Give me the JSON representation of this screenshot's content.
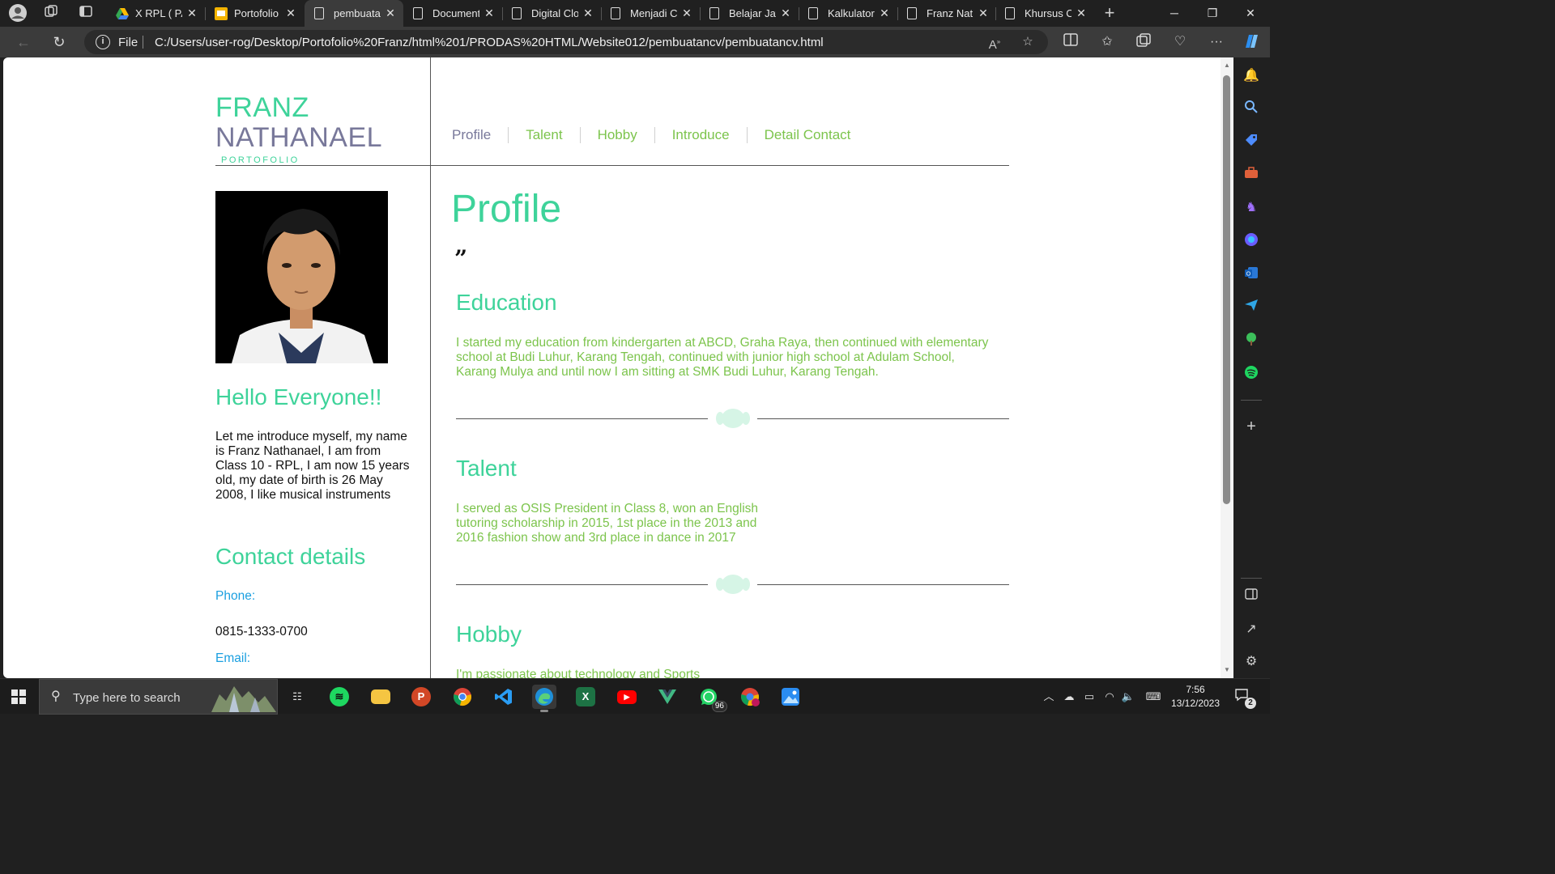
{
  "browser": {
    "tabs": [
      {
        "title": "X RPL ( PA",
        "icon": "google-drive-icon",
        "active": false
      },
      {
        "title": "Portofolio",
        "icon": "google-slides-icon",
        "active": false
      },
      {
        "title": "pembuata",
        "icon": "file-icon",
        "active": true
      },
      {
        "title": "Document",
        "icon": "file-icon",
        "active": false
      },
      {
        "title": "Digital Clo",
        "icon": "file-icon",
        "active": false
      },
      {
        "title": "Menjadi C",
        "icon": "file-icon",
        "active": false
      },
      {
        "title": "Belajar Jav",
        "icon": "file-icon",
        "active": false
      },
      {
        "title": "Kalkulator",
        "icon": "file-icon",
        "active": false
      },
      {
        "title": "Franz Nath",
        "icon": "file-icon",
        "active": false
      },
      {
        "title": "Khursus C",
        "icon": "file-icon",
        "active": false
      }
    ],
    "address": {
      "scheme_label": "File",
      "url": "C:/Users/user-rog/Desktop/Portofolio%20Franz/html%201/PRODAS%20HTML/Website012/pembuatancv/pembuatancv.html"
    }
  },
  "site": {
    "logo": {
      "line1": "FRANZ",
      "line2": "NATHANAEL",
      "tagline": "PORTOFOLIO"
    },
    "nav": [
      "Profile",
      "Talent",
      "Hobby",
      "Introduce",
      "Detail Contact"
    ],
    "sidebar": {
      "greeting": "Hello Everyone!!",
      "intro": "Let me introduce myself, my name is Franz Nathanael, I am from Class 10 - RPL, I am now 15 years old, my date of birth is 26 May 2008, I like musical instruments",
      "contact_title": "Contact details",
      "phone_label": "Phone:",
      "phone": "0815-1333-0700",
      "email_label": "Email:"
    },
    "main": {
      "title": "Profile",
      "quote_mark": "”",
      "sections": [
        {
          "heading": "Education",
          "text": "I started my education from kindergarten at ABCD, Graha Raya, then continued with elementary school at Budi Luhur, Karang Tengah, continued with junior high school at Adulam School, Karang Mulya and until now I am sitting at SMK Budi Luhur, Karang Tengah."
        },
        {
          "heading": "Talent",
          "text": "I served as OSIS President in Class 8, won an English tutoring scholarship in 2015, 1st place in the 2013 and 2016 fashion show and 3rd place in dance in 2017"
        },
        {
          "heading": "Hobby",
          "text": "I'm passionate about technology and Sports"
        }
      ]
    },
    "colors": {
      "accent": "#3ed39a",
      "nav_text": "#7cc44c",
      "logo_secondary": "#78789a",
      "link_blue": "#1a9fe0"
    }
  },
  "taskbar": {
    "search_placeholder": "Type here to search",
    "whatsapp_badge": "96",
    "time": "7:56",
    "date": "13/12/2023",
    "notification_count": "2"
  }
}
